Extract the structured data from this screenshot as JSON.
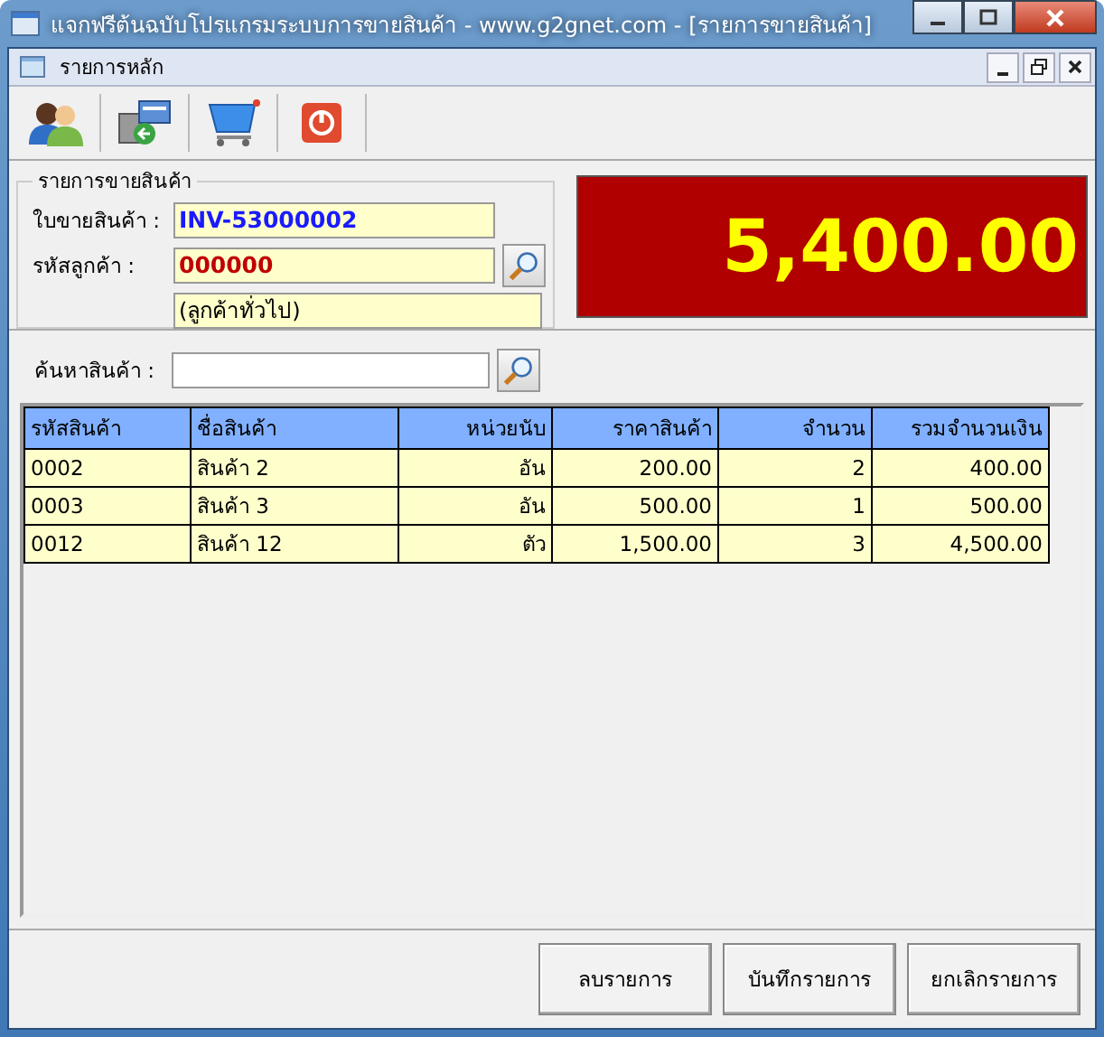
{
  "window": {
    "title": "แจกฟรีต้นฉบับโปรแกรมระบบการขายสินค้า - www.g2gnet.com - [รายการขายสินค้า]"
  },
  "child_window": {
    "title": "รายการหลัก"
  },
  "toolbar": [
    {
      "kind": "people"
    },
    {
      "kind": "export"
    },
    {
      "kind": "cart"
    },
    {
      "kind": "power"
    }
  ],
  "sale": {
    "group_title": "รายการขายสินค้า",
    "invoice": {
      "label": "ใบขายสินค้า :",
      "value": "INV-53000002"
    },
    "customer": {
      "label": "รหัสลูกค้า :",
      "value": "000000",
      "name": "(ลูกค้าทั่วไป)"
    },
    "total": "5,400.00"
  },
  "search": {
    "label": "ค้นหาสินค้า :"
  },
  "table": {
    "columns": [
      "รหัสสินค้า",
      "ชื่อสินค้า",
      "หน่วยนับ",
      "ราคาสินค้า",
      "จำนวน",
      "รวมจำนวนเงิน"
    ],
    "rows": [
      [
        "0002",
        "สินค้า 2",
        "อัน",
        "200.00",
        "2",
        "400.00"
      ],
      [
        "0003",
        "สินค้า 3",
        "อัน",
        "500.00",
        "1",
        "500.00"
      ],
      [
        "0012",
        "สินค้า 12",
        "ตัว",
        "1,500.00",
        "3",
        "4,500.00"
      ]
    ]
  },
  "buttons": [
    "ลบรายการ",
    "บันทึกรายการ",
    "ยกเลิกรายการ"
  ]
}
